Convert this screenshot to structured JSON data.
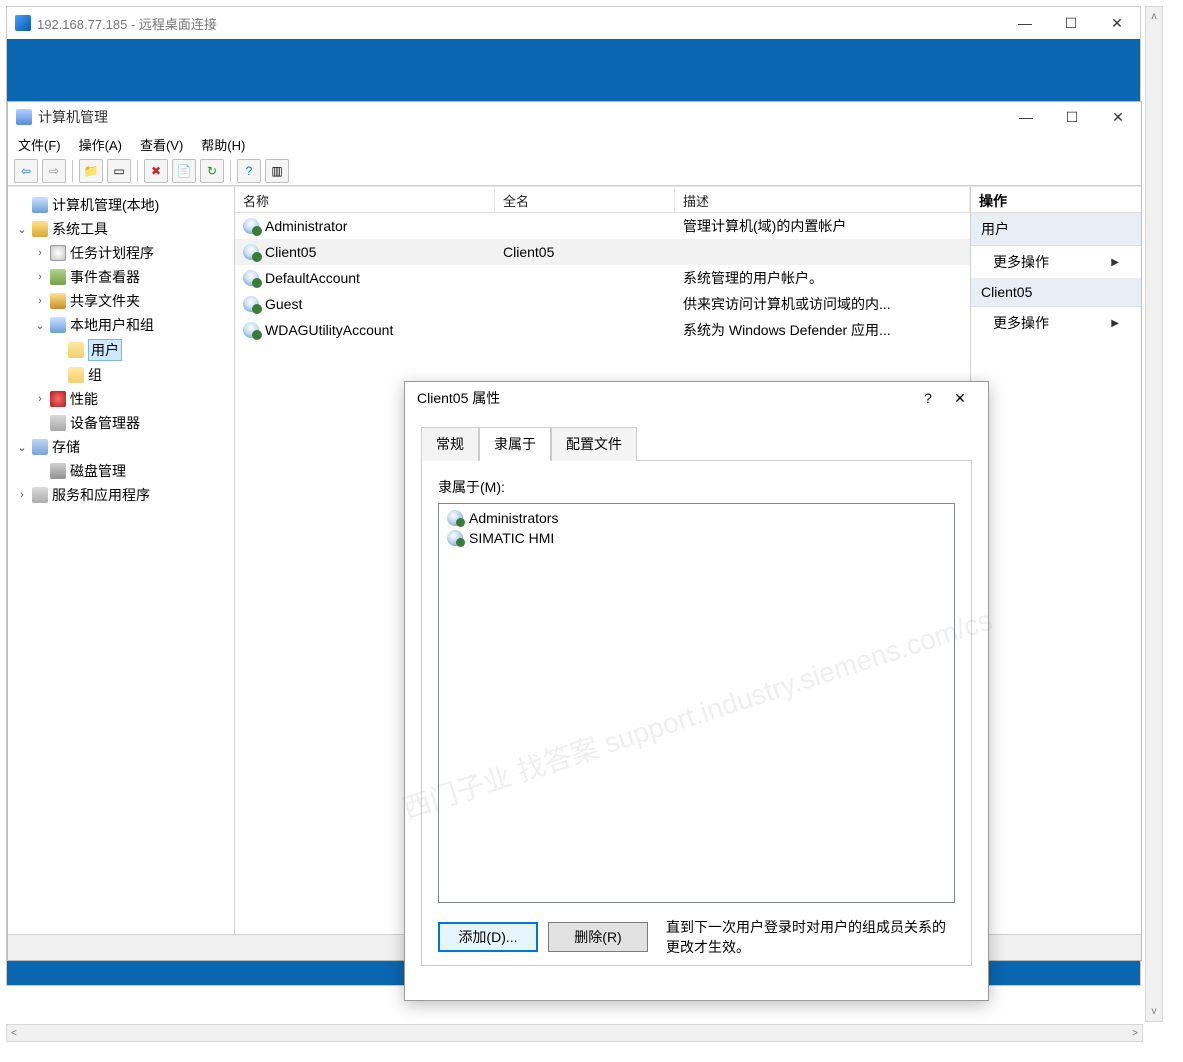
{
  "rdp": {
    "title": "192.168.77.185 - 远程桌面连接"
  },
  "mmc": {
    "title": "计算机管理",
    "menu": {
      "file": "文件(F)",
      "action": "操作(A)",
      "view": "查看(V)",
      "help": "帮助(H)"
    },
    "tree": {
      "root": "计算机管理(本地)",
      "sys_tools": "系统工具",
      "task_scheduler": "任务计划程序",
      "event_viewer": "事件查看器",
      "shared_folders": "共享文件夹",
      "local_users_groups": "本地用户和组",
      "users": "用户",
      "groups": "组",
      "performance": "性能",
      "device_manager": "设备管理器",
      "storage": "存储",
      "disk_mgmt": "磁盘管理",
      "services_apps": "服务和应用程序"
    },
    "list": {
      "cols": {
        "name": "名称",
        "fullname": "全名",
        "desc": "描述"
      },
      "rows": [
        {
          "name": "Administrator",
          "fullname": "",
          "desc": "管理计算机(域)的内置帐户"
        },
        {
          "name": "Client05",
          "fullname": "Client05",
          "desc": "",
          "selected": true
        },
        {
          "name": "DefaultAccount",
          "fullname": "",
          "desc": "系统管理的用户帐户。"
        },
        {
          "name": "Guest",
          "fullname": "",
          "desc": "供来宾访问计算机或访问域的内..."
        },
        {
          "name": "WDAGUtilityAccount",
          "fullname": "",
          "desc": "系统为 Windows Defender 应用..."
        }
      ]
    },
    "actions": {
      "header": "操作",
      "group1": "用户",
      "more1": "更多操作",
      "group2": "Client05",
      "more2": "更多操作"
    }
  },
  "dialog": {
    "title": "Client05 属性",
    "tabs": {
      "general": "常规",
      "memberof": "隶属于",
      "profile": "配置文件"
    },
    "label": "隶属于(M):",
    "members": [
      "Administrators",
      "SIMATIC HMI"
    ],
    "btn_add": "添加(D)...",
    "btn_remove": "删除(R)",
    "note": "直到下一次用户登录时对用户的组成员关系的更改才生效。"
  },
  "watermark": "西门子业 找答案\nsupport.industry.siemens.com/cs"
}
